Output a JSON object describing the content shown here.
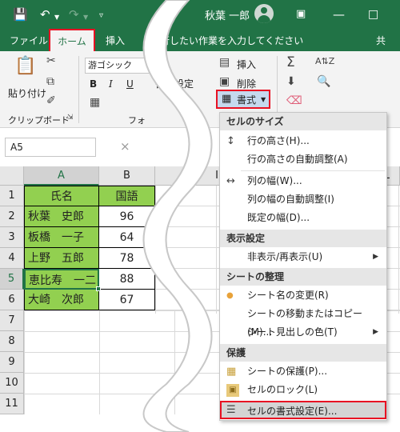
{
  "titlebar": {
    "user_name": "秋葉 一郎",
    "icons": [
      "save-icon",
      "undo-icon",
      "redo-icon",
      "customize-icon",
      "ribbon-display-icon",
      "minimize-icon",
      "maximize-icon",
      "close-icon"
    ]
  },
  "menubar": {
    "file": "ファイル",
    "home": "ホーム",
    "insert": "挿入",
    "tell_me": "行したい作業を入力してください",
    "share": "共"
  },
  "ribbon": {
    "paste": "貼り付け",
    "clipboard": "クリップボード",
    "font_name": "游ゴシック",
    "bold": "B",
    "italic": "I",
    "underline": "U",
    "font_group": "フォ",
    "cell_format_partial": "書式設定",
    "insert": "挿入",
    "delete": "削除",
    "format": "書式"
  },
  "formulabar": {
    "name_box": "A5",
    "cancel": "×"
  },
  "sheet": {
    "columns": [
      "A",
      "B",
      "I",
      "L"
    ],
    "rows": [
      "1",
      "2",
      "3",
      "4",
      "5",
      "6",
      "7",
      "8",
      "9",
      "10",
      "11"
    ],
    "header": {
      "name": "氏名",
      "subject": "国語"
    },
    "data": [
      {
        "name": "秋葉　史郎",
        "score": "96"
      },
      {
        "name": "板橋　一子",
        "score": "64"
      },
      {
        "name": "上野　五郎",
        "score": "78"
      },
      {
        "name": "恵比寿　一二",
        "score": "88"
      },
      {
        "name": "大崎　次郎",
        "score": "67"
      }
    ]
  },
  "menu": {
    "cell_size_header": "セルのサイズ",
    "row_height": "行の高さ(H)...",
    "autofit_row": "行の高さの自動調整(A)",
    "col_width": "列の幅(W)...",
    "autofit_col": "列の幅の自動調整(I)",
    "default_width": "既定の幅(D)...",
    "visibility_header": "表示設定",
    "hide_unhide": "非表示/再表示(U)",
    "organize_header": "シートの整理",
    "rename": "シート名の変更(R)",
    "move_copy": "シートの移動またはコピー(M)...",
    "tab_color": "シート見出しの色(T)",
    "protection_header": "保護",
    "protect_sheet": "シートの保護(P)...",
    "lock_cell": "セルのロック(L)",
    "format_cells": "セルの書式設定(E)..."
  },
  "colors": {
    "excel_green": "#217346",
    "highlight_red": "#e81123",
    "cell_green": "#92d050"
  }
}
